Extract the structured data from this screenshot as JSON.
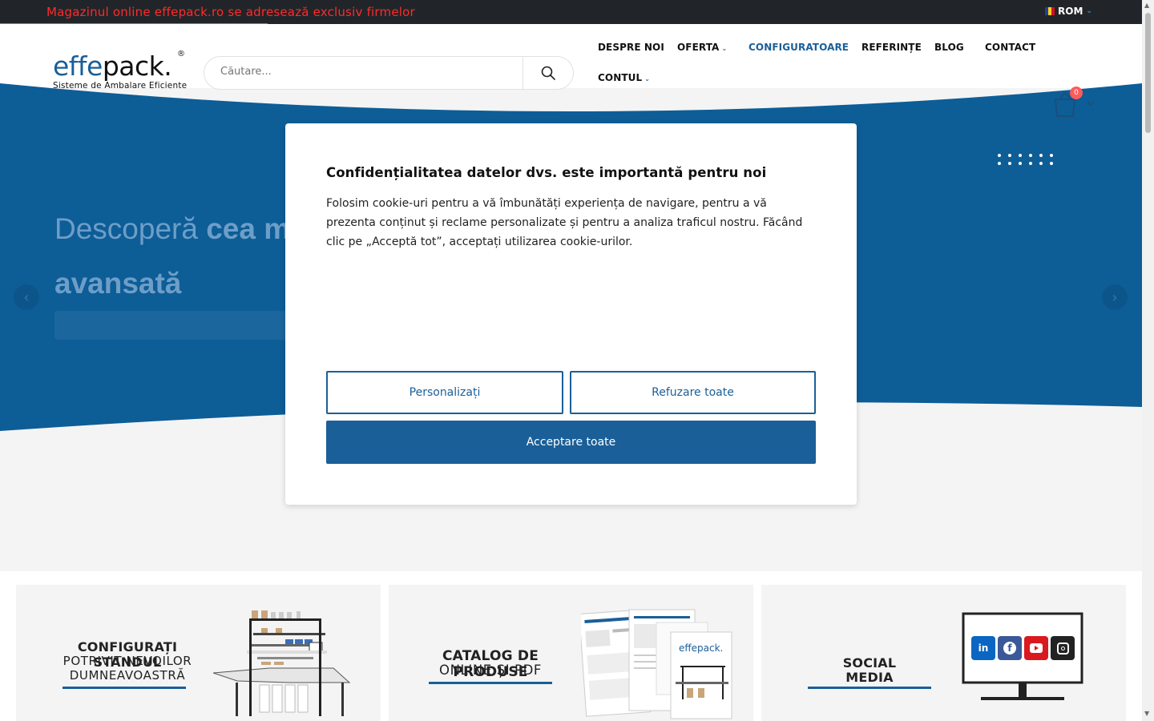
{
  "topbar": {
    "announcement": "Magazinul online effepack.ro se adresează exclusiv firmelor",
    "language": "ROM"
  },
  "logo": {
    "brand_blue": "effe",
    "brand_dark": "pack.",
    "registered": "®",
    "tagline": "Sisteme de Ambalare Eficiente"
  },
  "search": {
    "placeholder": "Căutare..."
  },
  "nav": {
    "items": [
      {
        "label": "DESPRE NOI"
      },
      {
        "label": "OFERTA"
      },
      {
        "label": "CONFIGURATOARE"
      },
      {
        "label": "REFERINȚE"
      },
      {
        "label": "BLOG"
      },
      {
        "label": "CONTACT"
      },
      {
        "label": "CONTUL"
      }
    ]
  },
  "cart": {
    "count": "0"
  },
  "hero": {
    "line1_light": "Descoperă ",
    "line1_bold": "cea ma",
    "line2": "avansată"
  },
  "cookie_modal": {
    "title": "Confidențialitatea datelor dvs. este importantă pentru noi",
    "body": "Folosim cookie-uri pentru a vă îmbunătăți experiența de navigare, pentru a vă prezenta conținut și reclame personalizate și pentru a analiza traficul nostru. Făcând clic pe „Acceptă tot”, acceptați utilizarea cookie-urilor.",
    "customize_label": "Personalizați",
    "reject_label": "Refuzare toate",
    "accept_label": "Acceptare toate"
  },
  "cards": {
    "configurator": {
      "title": "CONFIGURAȚI STANDUL",
      "line2": "POTRIVIT NEVOILOR",
      "line3": "DUMNEAVOASTRĂ"
    },
    "catalog": {
      "title": "CATALOG DE PRODUSE",
      "line2": "ONLINE ȘI PDF",
      "brand": "effepack."
    },
    "social": {
      "title": "SOCIAL",
      "line2": "MEDIA"
    }
  },
  "colors": {
    "brand_blue": "#1a5f98",
    "topbar_bg": "#212529",
    "announcement": "#ff2a2a",
    "hero_blue": "#0d5d97"
  },
  "icons": [
    "search-icon",
    "cart-icon",
    "chevron-down-icon",
    "arrow-left-icon",
    "arrow-right-icon",
    "linkedin-icon",
    "facebook-icon",
    "youtube-icon",
    "instagram-icon",
    "romania-flag-icon"
  ]
}
